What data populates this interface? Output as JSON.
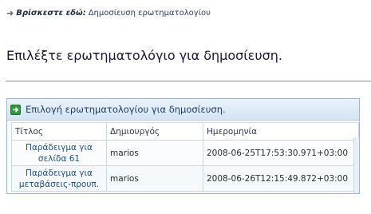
{
  "breadcrumb": {
    "prefix": "Βρίσκεστε εδώ:",
    "current": "Δημοσίευση ερωτηματολογίου"
  },
  "page": {
    "title": "Επιλέξτε ερωτηματολόγιο για δημοσίευση."
  },
  "panel": {
    "title": "Επιλογή ερωτηματολογίου για δημοσίευση.",
    "icon": "go-arrow-icon",
    "icon_color": "#2e9b3a"
  },
  "table": {
    "headers": {
      "title": "Τίτλος",
      "creator": "Δημιουργός",
      "date": "Ημερομηνία"
    },
    "rows": [
      {
        "title_line1": "Παράδειγμα για",
        "title_line2": "σελίδα 61",
        "creator": "marios",
        "date": "2008-06-25T17:53:30.971+03:00"
      },
      {
        "title_line1": "Παράδειγμα για",
        "title_line2": "μεταβάσεις-προυπ.",
        "creator": "marios",
        "date": "2008-06-26T12:15:49.872+03:00"
      }
    ]
  },
  "colors": {
    "panel_border": "#9ab7d3",
    "link": "#1f4e79"
  }
}
